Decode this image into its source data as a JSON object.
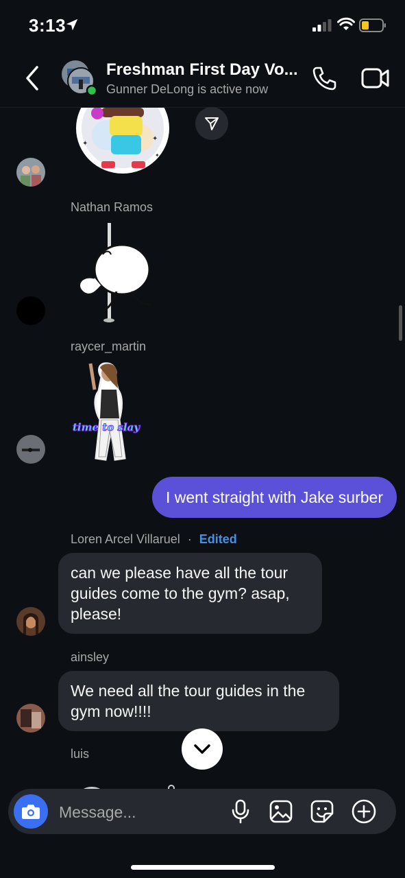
{
  "status_bar": {
    "time": "3:13",
    "icons": [
      "location-arrow-icon",
      "signal-icon",
      "wifi-icon",
      "battery-icon"
    ]
  },
  "header": {
    "title": "Freshman First Day Vo...",
    "subtitle": "Gunner DeLong is active now",
    "icons": [
      "back-icon",
      "phone-icon",
      "video-camera-icon"
    ]
  },
  "messages": {
    "nathan": {
      "sender": "Nathan Ramos"
    },
    "raycer": {
      "sender": "raycer_martin"
    },
    "raycer_sticker_text": "time to slay",
    "outgoing": {
      "text": "I went straight with Jake surber"
    },
    "loren": {
      "sender": "Loren Arcel Villaruel",
      "separator": "·",
      "edited": "Edited",
      "text": "can we please have all the tour guides come to the gym? asap, please!"
    },
    "ainsley": {
      "sender": "ainsley",
      "text": "We need all the tour guides in the gym now!!!!"
    },
    "luis": {
      "sender": "luis"
    }
  },
  "composer": {
    "placeholder": "Message...",
    "icons": [
      "camera-icon",
      "microphone-icon",
      "gallery-icon",
      "sticker-icon",
      "add-icon"
    ]
  },
  "colors": {
    "accent": "#5b51d8",
    "camera": "#3b6ff1",
    "background": "#0c1014",
    "bubble_in": "#262a30",
    "edited": "#4a90e2"
  }
}
